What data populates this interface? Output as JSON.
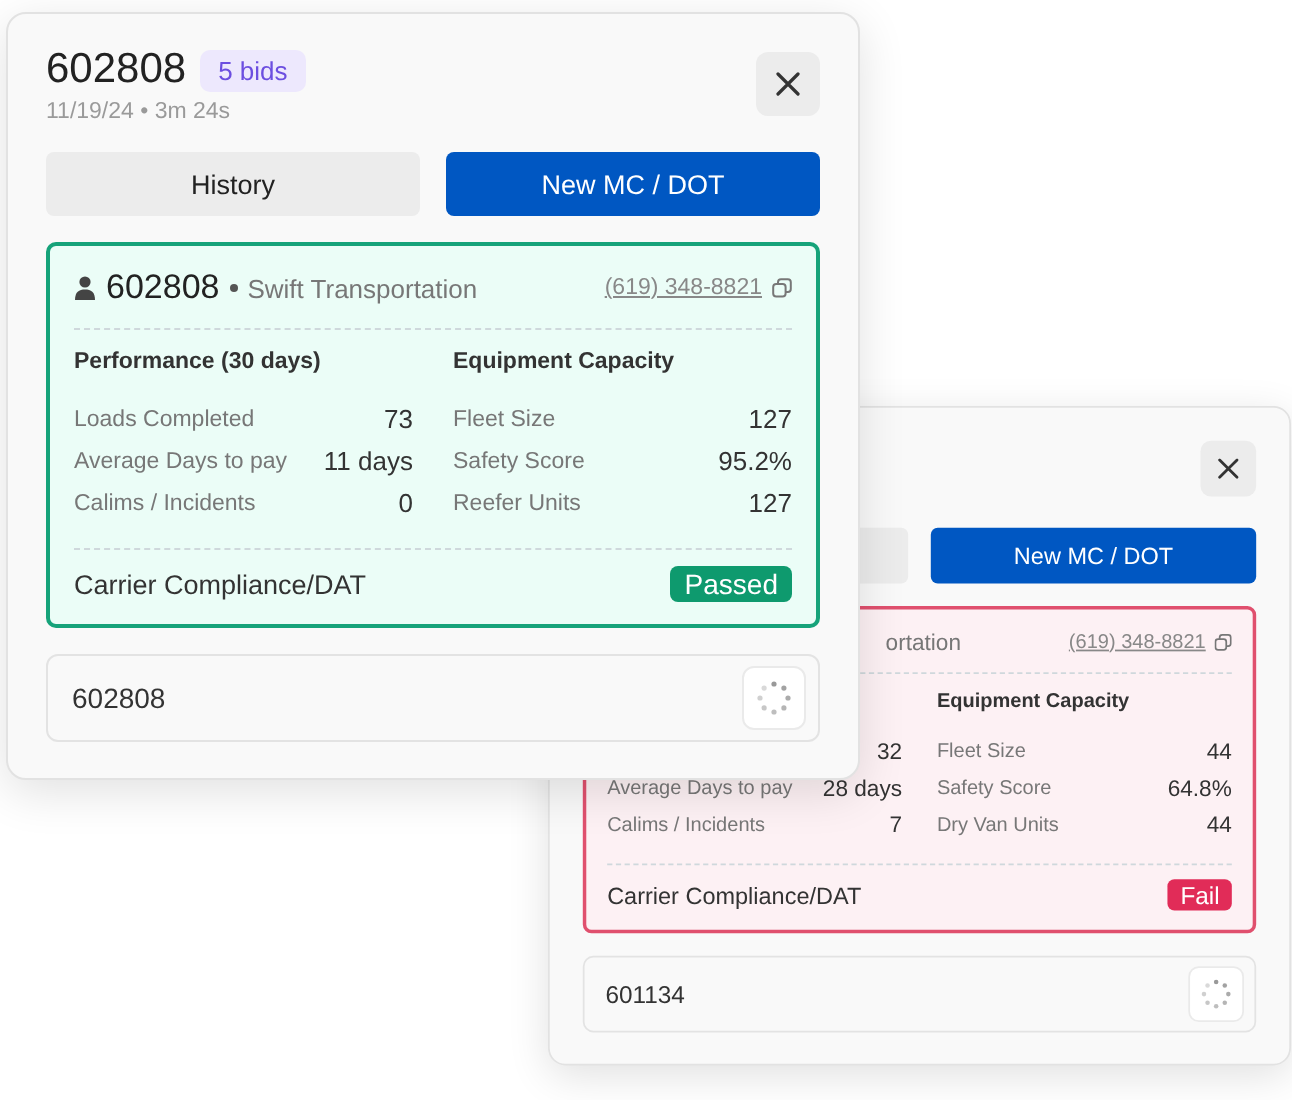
{
  "windows": [
    {
      "title": "602808",
      "badge": "5 bids",
      "subtitle": "11/19/24 • 3m 24s",
      "buttons": [
        {
          "label": "History",
          "primary": false
        },
        {
          "label": "New MC / DOT",
          "primary": true
        }
      ],
      "carrier": {
        "id": "602808",
        "company": "Swift Transportation",
        "phone": "(619) 348-8821",
        "passed": true,
        "sections": [
          {
            "heading": "Performance (30 days)",
            "rows": [
              {
                "label": "Loads Completed",
                "value": "73"
              },
              {
                "label": "Average Days to pay",
                "value": "11 days"
              },
              {
                "label": "Calims / Incidents",
                "value": "0"
              }
            ]
          },
          {
            "heading": "Equipment Capacity",
            "rows": [
              {
                "label": "Fleet Size",
                "value": "127"
              },
              {
                "label": "Safety Score",
                "value": "95.2%"
              },
              {
                "label": "Reefer Units",
                "value": "127"
              }
            ]
          }
        ],
        "compliance": "Carrier Compliance/DAT",
        "result": "Passed"
      },
      "input": {
        "value": "602808"
      }
    },
    {
      "buttons": [
        {
          "primary": false
        },
        {
          "label": "New MC / DOT",
          "primary": true
        }
      ],
      "carrier": {
        "company": "ortation",
        "phone": "(619) 348-8821",
        "passed": false,
        "sections": [
          {
            "rows": [
              {
                "value": "32"
              },
              {
                "label": "Average Days to pay",
                "value": "28 days"
              },
              {
                "label": "Calims / Incidents",
                "value": "7"
              }
            ]
          },
          {
            "heading": "Equipment Capacity",
            "rows": [
              {
                "label": "Fleet Size",
                "value": "44"
              },
              {
                "label": "Safety Score",
                "value": "64.8%"
              },
              {
                "label": "Dry Van Units",
                "value": "44"
              }
            ]
          }
        ],
        "compliance": "Carrier Compliance/DAT",
        "result": "Fail"
      },
      "input": {
        "value": "601134"
      }
    }
  ]
}
